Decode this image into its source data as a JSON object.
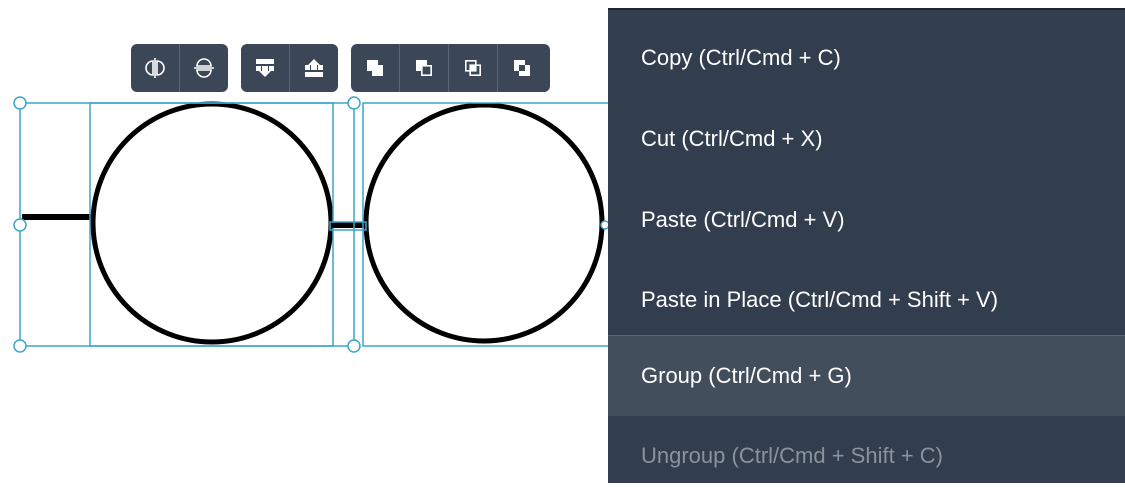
{
  "toolbar": {
    "groups": [
      {
        "buttons": [
          {
            "icon": "flip-horizontal-icon",
            "label": "Flip horizontally"
          },
          {
            "icon": "flip-vertical-icon",
            "label": "Flip vertically"
          }
        ]
      },
      {
        "buttons": [
          {
            "icon": "send-down-icon",
            "label": "Move down"
          },
          {
            "icon": "bring-up-icon",
            "label": "Move up"
          }
        ]
      },
      {
        "buttons": [
          {
            "icon": "union-icon",
            "label": "Union"
          },
          {
            "icon": "subtract-icon",
            "label": "Subtract"
          },
          {
            "icon": "intersect-icon",
            "label": "Intersect"
          },
          {
            "icon": "exclude-icon",
            "label": "Exclude"
          }
        ]
      }
    ]
  },
  "context_menu": {
    "items": [
      {
        "label": "Copy (Ctrl/Cmd + C)",
        "enabled": true,
        "highlighted": false
      },
      {
        "label": "Cut (Ctrl/Cmd + X)",
        "enabled": true,
        "highlighted": false
      },
      {
        "label": "Paste (Ctrl/Cmd + V)",
        "enabled": true,
        "highlighted": false
      },
      {
        "label": "Paste in Place (Ctrl/Cmd + Shift + V)",
        "enabled": true,
        "highlighted": false
      },
      {
        "label": "Group (Ctrl/Cmd + G)",
        "enabled": true,
        "highlighted": true
      },
      {
        "label": "Ungroup (Ctrl/Cmd + Shift + C)",
        "enabled": false,
        "highlighted": false
      }
    ]
  },
  "colors": {
    "selection": "#3aa6c9",
    "menu_background": "#323d4d",
    "menu_highlight": "#434e5d",
    "toolbar_background": "#3b4656"
  }
}
